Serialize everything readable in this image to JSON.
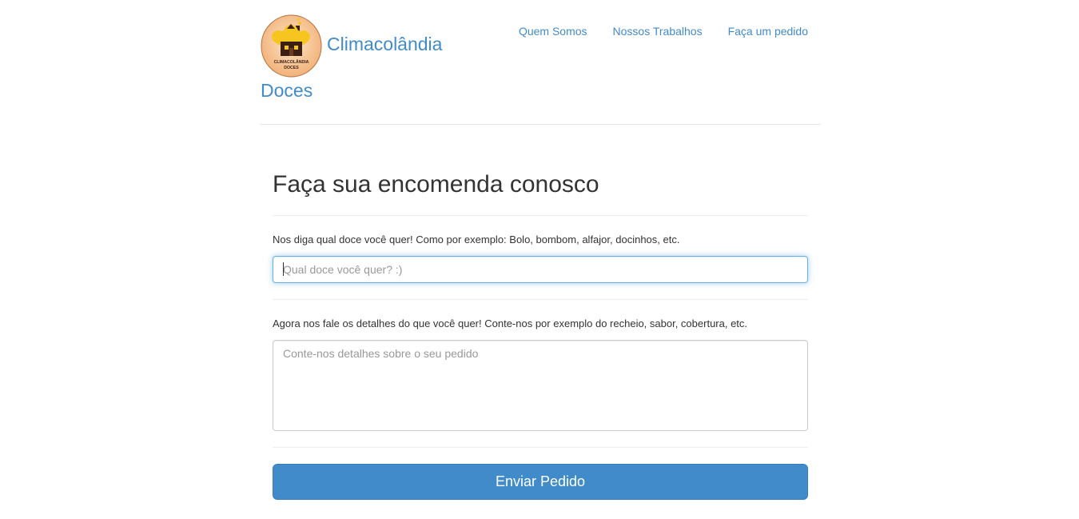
{
  "brand": {
    "name_line1": "Climacolândia",
    "name_line2": "Doces",
    "logo_text_line1": "CLIMACOLÂNDIA",
    "logo_text_line2": "DOCES"
  },
  "nav": {
    "items": [
      {
        "label": "Quem Somos"
      },
      {
        "label": "Nossos Trabalhos"
      },
      {
        "label": "Faça um pedido"
      }
    ]
  },
  "form": {
    "title": "Faça sua encomenda conosco",
    "sweet_label": "Nos diga qual doce você quer! Como por exemplo: Bolo, bombom, alfajor, docinhos, etc.",
    "sweet_placeholder": "Qual doce você quer? :)",
    "sweet_value": "",
    "details_label": "Agora nos fale os detalhes do que você quer! Conte-nos por exemplo do recheio, sabor, cobertura, etc.",
    "details_placeholder": "Conte-nos detalhes sobre o seu pedido",
    "details_value": "",
    "submit_label": "Enviar Pedido"
  },
  "colors": {
    "link": "#428bca",
    "primary_button": "#428bca",
    "logo_bg": "#f5c08a",
    "logo_house": "#f7c520",
    "logo_roof": "#3b1f12"
  },
  "icons": {
    "logo": "cupcake-house-logo"
  }
}
